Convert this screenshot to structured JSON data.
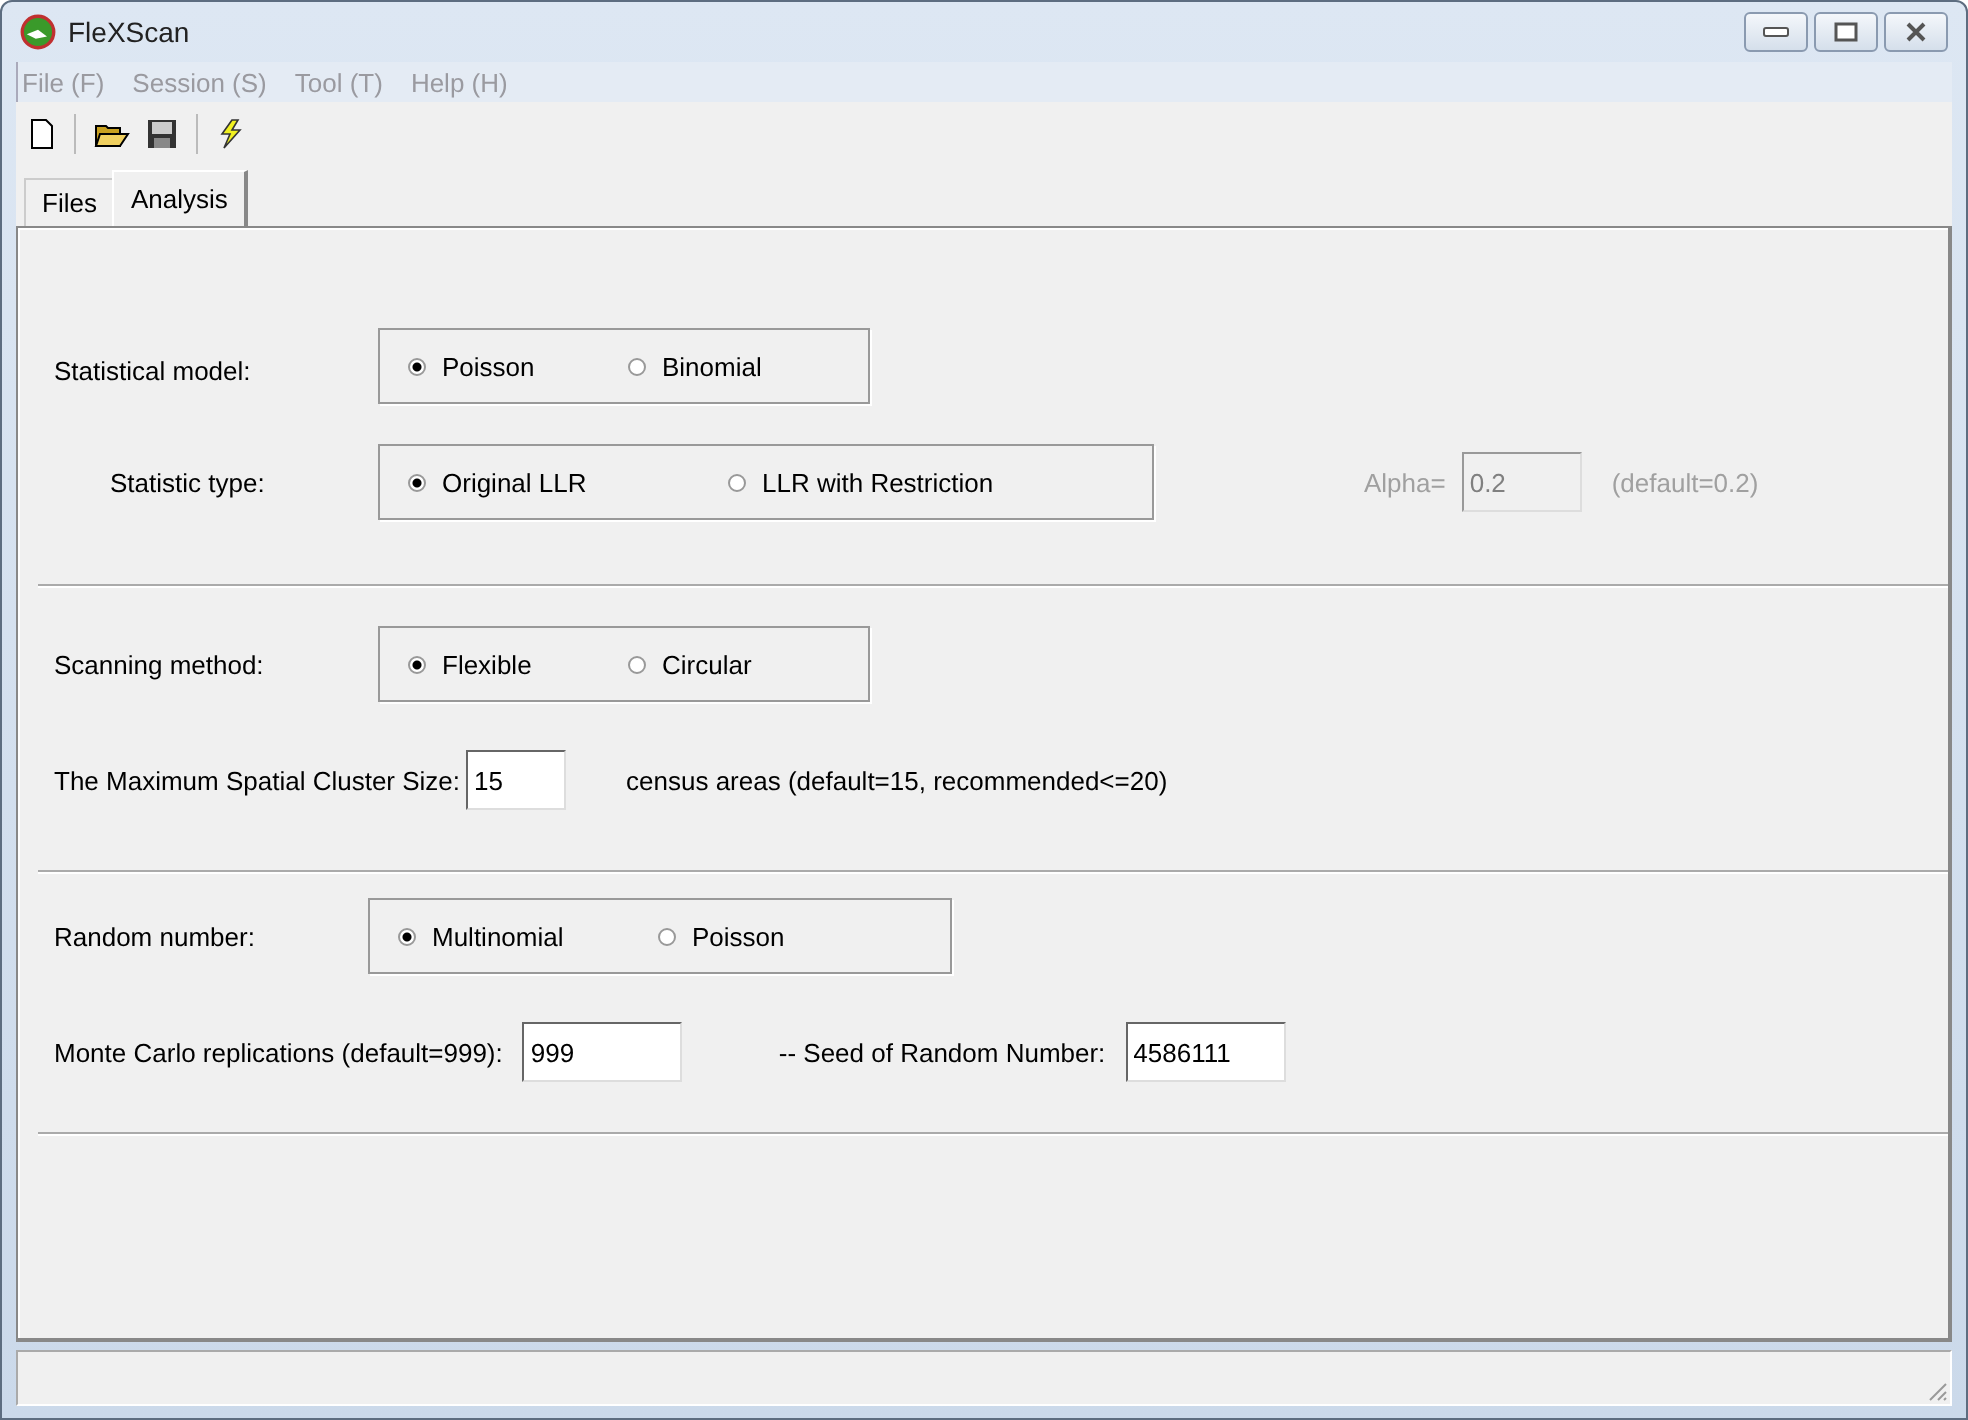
{
  "window": {
    "title": "FleXScan"
  },
  "menu": [
    "File (F)",
    "Session (S)",
    "Tool (T)",
    "Help (H)"
  ],
  "tabs": [
    {
      "label": "Files",
      "selected": false
    },
    {
      "label": "Analysis",
      "selected": true
    }
  ],
  "sections": [
    {
      "rows": [
        {
          "items": [
            {
              "kind": "label",
              "text": "Statistical model:",
              "disabled": false
            },
            {
              "kind": "radios",
              "disabled": false,
              "options": [
                {
                  "label": "Poisson",
                  "selected": true
                },
                {
                  "label": "Binomial",
                  "selected": false
                }
              ]
            }
          ]
        },
        {
          "items": [
            {
              "kind": "label",
              "text": "Statistic type:",
              "disabled": false
            },
            {
              "kind": "radios",
              "disabled": false,
              "options": [
                {
                  "label": "Original LLR",
                  "selected": true
                },
                {
                  "label": "LLR with Restriction",
                  "selected": false
                }
              ]
            },
            {
              "kind": "label",
              "text": "Alpha=",
              "disabled": true
            },
            {
              "kind": "field",
              "value": "0.2",
              "disabled": true
            },
            {
              "kind": "label",
              "text": "(default=0.2)",
              "disabled": true
            }
          ]
        }
      ]
    },
    {
      "rows": [
        {
          "items": [
            {
              "kind": "label",
              "text": "Scanning method:",
              "disabled": false
            },
            {
              "kind": "radios",
              "disabled": false,
              "options": [
                {
                  "label": "Flexible",
                  "selected": true
                },
                {
                  "label": "Circular",
                  "selected": false
                }
              ]
            }
          ]
        },
        {
          "items": [
            {
              "kind": "label",
              "text": "The Maximum Spatial Cluster Size:",
              "disabled": false
            },
            {
              "kind": "field",
              "value": "15",
              "disabled": false
            },
            {
              "kind": "label",
              "text": "census areas (default=15, recommended<=20)",
              "disabled": false
            }
          ]
        }
      ]
    },
    {
      "rows": [
        {
          "items": [
            {
              "kind": "label",
              "text": "Random number:",
              "disabled": false
            },
            {
              "kind": "radios",
              "disabled": false,
              "options": [
                {
                  "label": "Multinomial",
                  "selected": true
                },
                {
                  "label": "Poisson",
                  "selected": false
                }
              ]
            }
          ]
        },
        {
          "items": [
            {
              "kind": "label",
              "text": "Monte Carlo replications (default=999):",
              "disabled": false
            },
            {
              "kind": "field",
              "value": "999",
              "disabled": false
            },
            {
              "kind": "label",
              "text": "-- Seed of Random Number:",
              "disabled": false
            },
            {
              "kind": "field",
              "value": "4586111",
              "disabled": false
            }
          ]
        }
      ]
    }
  ]
}
